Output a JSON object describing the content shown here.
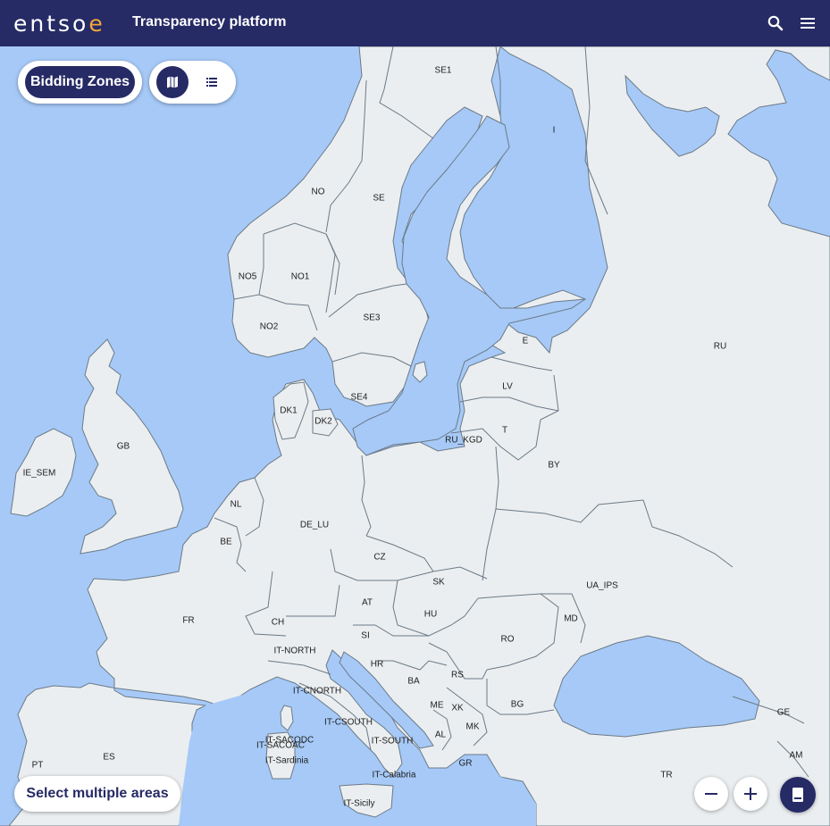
{
  "header": {
    "logo_text": "entso",
    "logo_accent": "e",
    "title": "Transparency platform",
    "icons": [
      "search-icon",
      "menu-icon"
    ]
  },
  "controls": {
    "zones_button_label": "Bidding Zones",
    "map_view_icon": "map-icon",
    "list_view_icon": "list-icon",
    "select_multiple_label": "Select multiple areas",
    "zoom_out_icon": "minus-icon",
    "zoom_in_icon": "plus-icon",
    "legend_icon": "book-icon"
  },
  "colors": {
    "brand_navy": "#262a65",
    "sea": "#a6c9f7",
    "land": "#ebeef0",
    "border": "#6b7a87",
    "logo_accent": "#f1a83a"
  },
  "zones": [
    "SE1",
    "I",
    "NO",
    "SE",
    "NO5",
    "NO1",
    "NO2",
    "SE3",
    "E",
    "RU",
    "LV",
    "SE4",
    "DK1",
    "DK2",
    "T",
    "RU_KGD",
    "GB",
    "BY",
    "IE_SEM",
    "NL",
    "DE_LU",
    "BE",
    "CZ",
    "SK",
    "UA_IPS",
    "AT",
    "HU",
    "MD",
    "FR",
    "CH",
    "SI",
    "RO",
    "IT-NORTH",
    "HR",
    "RS",
    "BA",
    "IT-CNORTH",
    "ME",
    "XK",
    "BG",
    "GE",
    "IT-CSOUTH",
    "IT-SACODC",
    "MK",
    "IT-SACOAC",
    "AL",
    "IT-SOUTH",
    "IT-Sardinia",
    "GR",
    "PT",
    "ES",
    "IT-Calabria",
    "TR",
    "AM",
    "IT-Sicily"
  ]
}
